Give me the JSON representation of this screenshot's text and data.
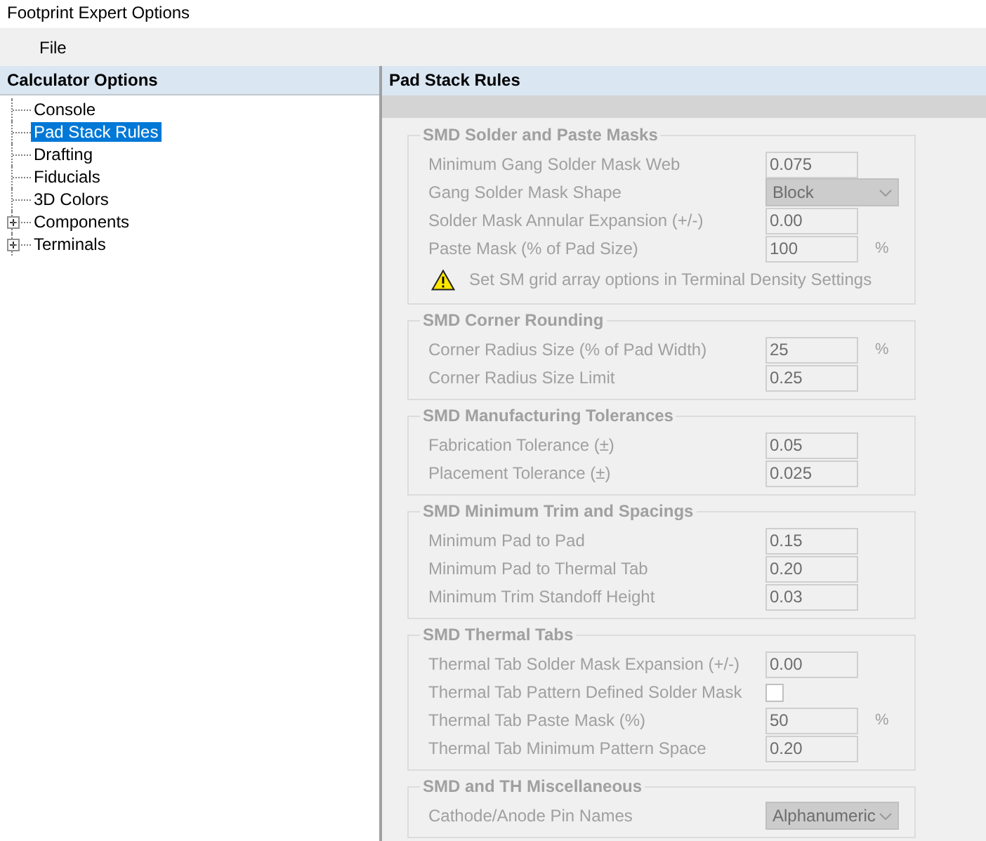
{
  "window": {
    "title": "Footprint Expert Options"
  },
  "menu": [
    "File"
  ],
  "sidebar": {
    "title": "Calculator Options",
    "items": [
      {
        "label": "Console",
        "selected": false
      },
      {
        "label": "Pad Stack Rules",
        "selected": true
      },
      {
        "label": "Drafting",
        "selected": false
      },
      {
        "label": "Fiducials",
        "selected": false
      },
      {
        "label": "3D Colors",
        "selected": false
      },
      {
        "label": "Components",
        "selected": false,
        "expanded": false
      },
      {
        "label": "Terminals",
        "selected": false,
        "expanded": false
      }
    ]
  },
  "panel": {
    "title": "Pad Stack Rules",
    "disabled": true,
    "groups": [
      {
        "title": "SMD Solder and Paste Masks",
        "rows": [
          {
            "kind": "input",
            "label": "Minimum Gang Solder Mask Web",
            "value": "0.075"
          },
          {
            "kind": "dropdown",
            "label": "Gang Solder Mask Shape",
            "value": "Block"
          },
          {
            "kind": "input",
            "label": "Solder Mask Annular Expansion (+/-)",
            "value": "0.00"
          },
          {
            "kind": "input",
            "label": "Paste Mask (% of Pad Size)",
            "value": "100",
            "unit": "%"
          },
          {
            "kind": "warning",
            "label": "Set SM grid array options in Terminal Density Settings"
          }
        ]
      },
      {
        "title": "SMD Corner Rounding",
        "rows": [
          {
            "kind": "input",
            "label": "Corner Radius Size (% of Pad Width)",
            "value": "25",
            "unit": "%"
          },
          {
            "kind": "input",
            "label": "Corner Radius Size Limit",
            "value": "0.25"
          }
        ]
      },
      {
        "title": "SMD Manufacturing Tolerances",
        "rows": [
          {
            "kind": "input",
            "label": "Fabrication Tolerance (±)",
            "value": "0.05"
          },
          {
            "kind": "input",
            "label": "Placement Tolerance (±)",
            "value": "0.025"
          }
        ]
      },
      {
        "title": "SMD Minimum Trim and Spacings",
        "rows": [
          {
            "kind": "input",
            "label": "Minimum Pad to Pad",
            "value": "0.15"
          },
          {
            "kind": "input",
            "label": "Minimum Pad to Thermal Tab",
            "value": "0.20"
          },
          {
            "kind": "input",
            "label": "Minimum Trim Standoff Height",
            "value": "0.03"
          }
        ]
      },
      {
        "title": "SMD Thermal Tabs",
        "rows": [
          {
            "kind": "input",
            "label": "Thermal Tab Solder Mask Expansion (+/-)",
            "value": "0.00"
          },
          {
            "kind": "checkbox",
            "label": "Thermal Tab Pattern Defined Solder Mask",
            "checked": false
          },
          {
            "kind": "input",
            "label": "Thermal Tab Paste Mask (%)",
            "value": "50",
            "unit": "%"
          },
          {
            "kind": "input",
            "label": "Thermal Tab Minimum Pattern Space",
            "value": "0.20"
          }
        ]
      },
      {
        "title": "SMD and TH Miscellaneous",
        "rows": [
          {
            "kind": "dropdown",
            "label": "Cathode/Anode Pin Names",
            "value": "Alphanumeric"
          }
        ]
      }
    ]
  }
}
